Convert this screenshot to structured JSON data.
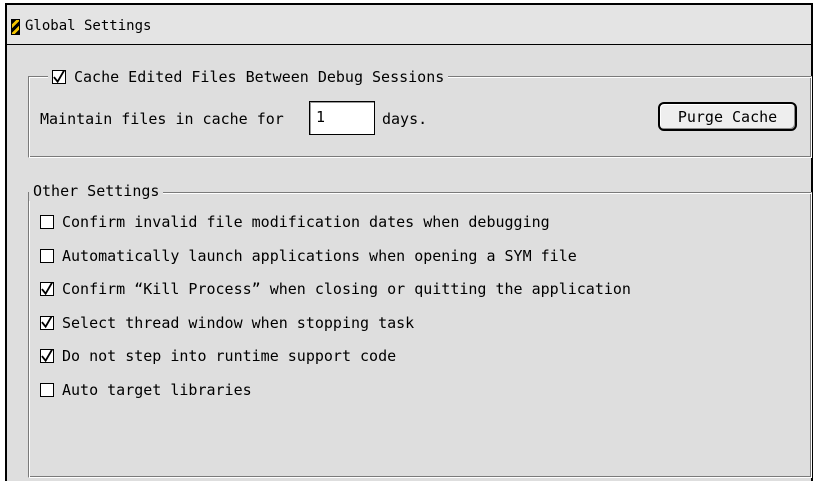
{
  "window": {
    "title": "Global Settings"
  },
  "cache_group": {
    "checkbox_label": "Cache Edited Files Between Debug Sessions",
    "checked": true,
    "maintain_label": "Maintain files in cache for",
    "days_value": "1",
    "days_suffix": "days.",
    "purge_button_label": "Purge Cache"
  },
  "other_settings": {
    "title": "Other Settings",
    "options": [
      {
        "label": "Confirm invalid file modification dates when debugging",
        "checked": false
      },
      {
        "label": "Automatically launch applications when opening a SYM file",
        "checked": false
      },
      {
        "label": "Confirm “Kill Process” when closing or quitting the application",
        "checked": true
      },
      {
        "label": "Select thread window when stopping task",
        "checked": true
      },
      {
        "label": "Do not step into runtime support code",
        "checked": true
      },
      {
        "label": "Auto target libraries",
        "checked": false
      }
    ]
  },
  "colors": {
    "panel_background": "#dedede",
    "title_icon_stripe": "#f2c400"
  }
}
